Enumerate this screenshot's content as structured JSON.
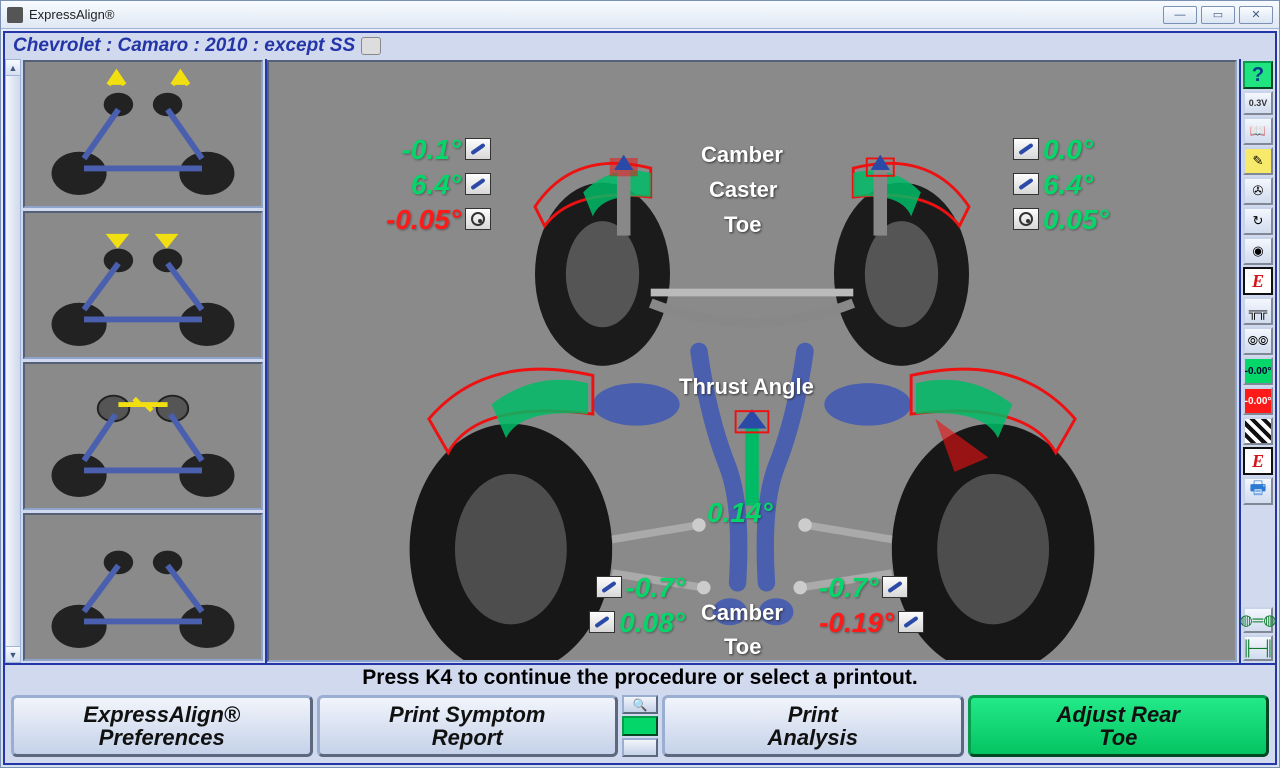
{
  "window": {
    "title": "ExpressAlign®"
  },
  "vehicle": "Chevrolet : Camaro : 2010 : except SS",
  "front": {
    "labels": {
      "camber": "Camber",
      "caster": "Caster",
      "toe": "Toe"
    },
    "left": {
      "camber": "-0.1°",
      "caster": "6.4°",
      "toe": "-0.05°"
    },
    "right": {
      "camber": "0.0°",
      "caster": "6.4°",
      "toe": "0.05°"
    }
  },
  "thrust": {
    "label": "Thrust Angle",
    "value": "0.14°"
  },
  "rear": {
    "labels": {
      "camber": "Camber",
      "toe": "Toe"
    },
    "left": {
      "camber": "-0.7°",
      "toe": "0.08°"
    },
    "right": {
      "camber": "-0.7°",
      "toe": "-0.19°"
    }
  },
  "hint": "Press K4 to continue the procedure or select a printout.",
  "buttons": {
    "preferences": "ExpressAlign®\nPreferences",
    "symptom": "Print Symptom\nReport",
    "analysis": "Print\nAnalysis",
    "adjust": "Adjust Rear\nToe"
  },
  "toolbar": {
    "help": "?",
    "voltage": "0.3V",
    "e": "E",
    "neg": "-0.00°",
    "pos": "-0.00°"
  }
}
